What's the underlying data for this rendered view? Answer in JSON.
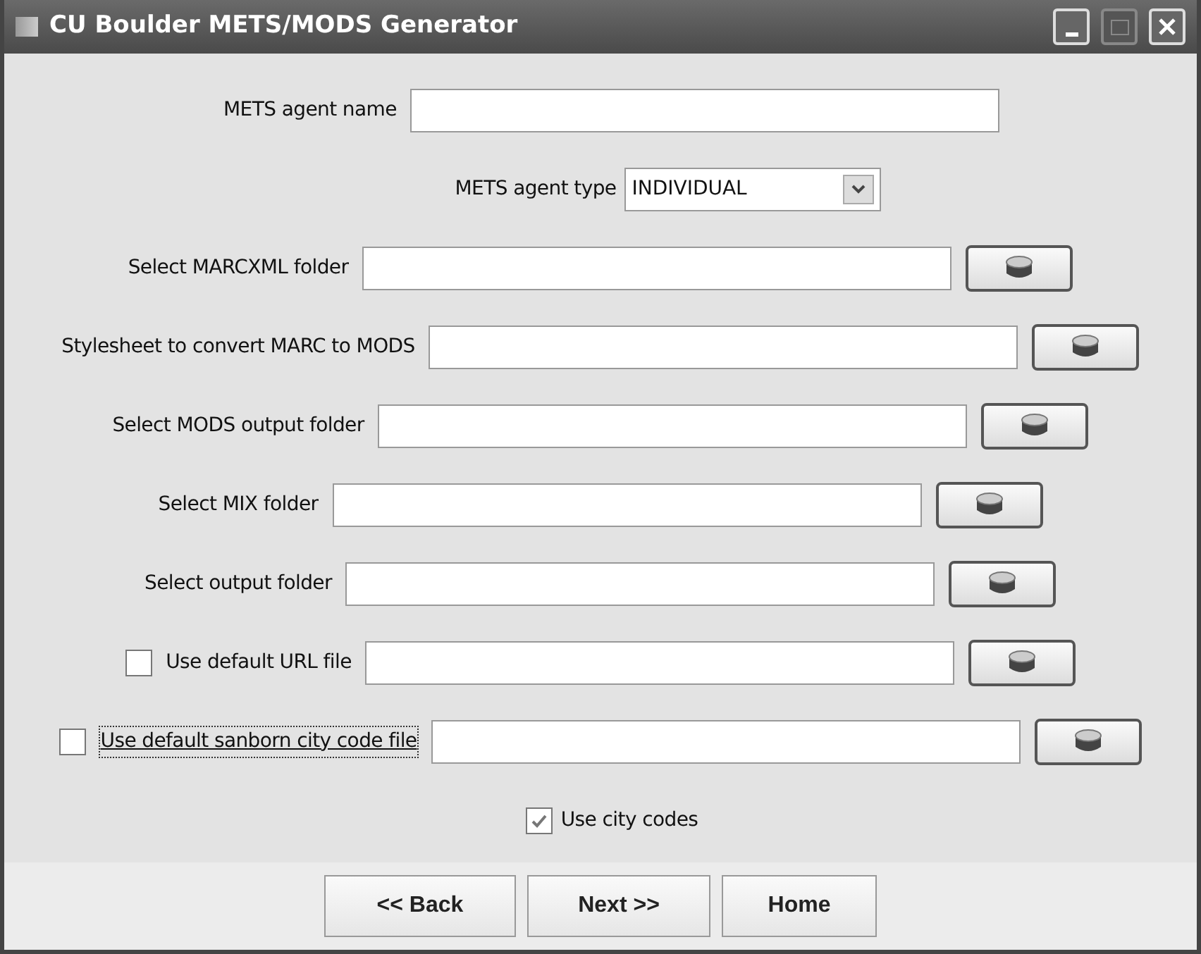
{
  "window": {
    "title": "CU Boulder METS/MODS Generator"
  },
  "rows": [
    {
      "kind": "text",
      "label": "METS agent name"
    },
    {
      "kind": "select",
      "label": "METS agent type",
      "value": "INDIVIDUAL"
    },
    {
      "kind": "folder",
      "label": "Select MARCXML folder"
    },
    {
      "kind": "folder",
      "label": "Stylesheet to convert MARC to MODS"
    },
    {
      "kind": "folder",
      "label": "Select MODS output folder"
    },
    {
      "kind": "folder",
      "label": "Select MIX folder"
    },
    {
      "kind": "folder",
      "label": "Select output folder"
    },
    {
      "kind": "checkfolder",
      "label": "Use default URL file",
      "checked": false,
      "focused": false
    },
    {
      "kind": "checkfolder",
      "label": "Use default sanborn city code file",
      "checked": false,
      "focused": true
    },
    {
      "kind": "check",
      "label": "Use city codes",
      "checked": true,
      "focused": false
    }
  ],
  "buttons": [
    "<< Back",
    "Next >>",
    "Home"
  ]
}
